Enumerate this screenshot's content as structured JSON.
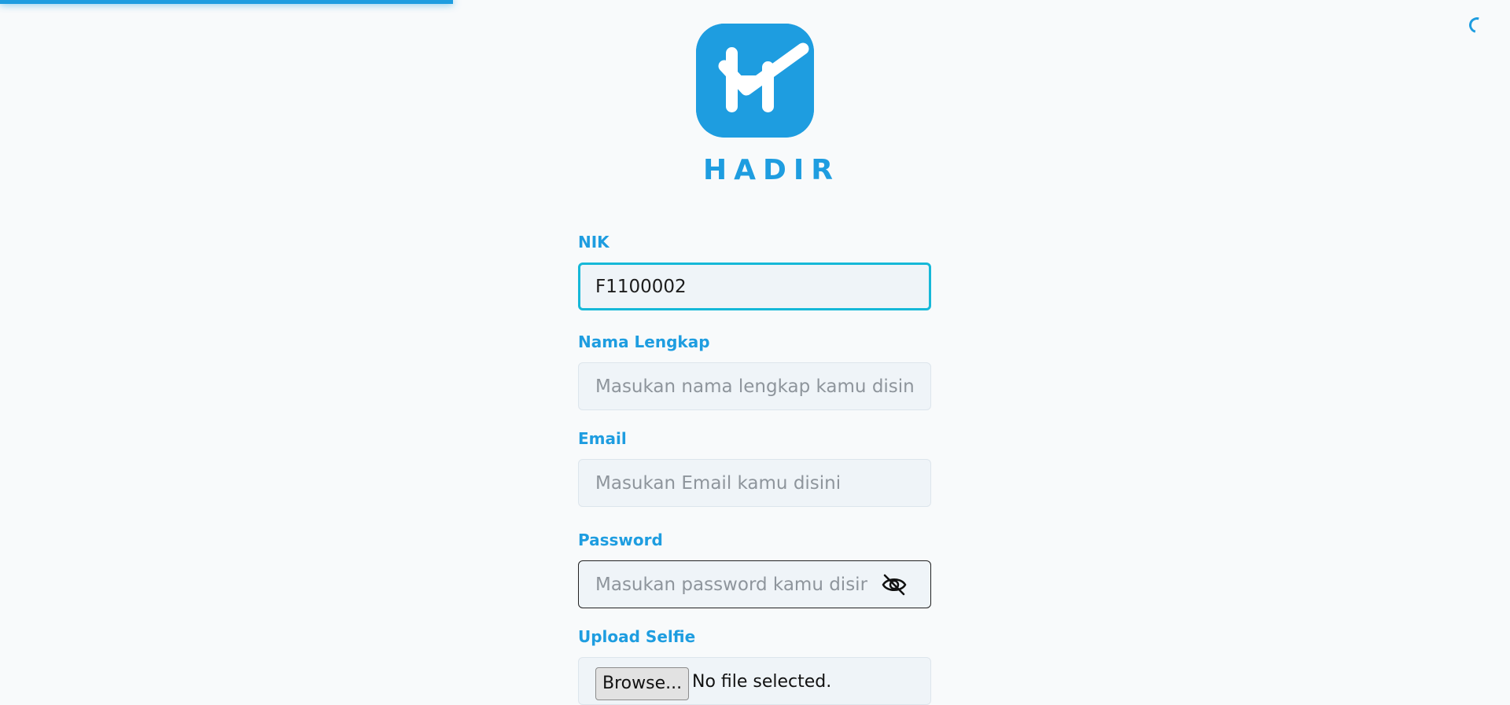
{
  "page_progress": {
    "percent": 30
  },
  "colors": {
    "accent": "#1e9de0",
    "focus": "#16b8d8",
    "input_bg": "#eff4f8"
  },
  "brand": {
    "name": "HADIR",
    "logo_icon": "h-checkmark-logo"
  },
  "form": {
    "nik": {
      "label": "NIK",
      "value": "F1100002",
      "placeholder": ""
    },
    "full_name": {
      "label": "Nama Lengkap",
      "value": "",
      "placeholder": "Masukan nama lengkap kamu disini"
    },
    "email": {
      "label": "Email",
      "value": "",
      "placeholder": "Masukan Email kamu disini"
    },
    "password": {
      "label": "Password",
      "value": "",
      "placeholder": "Masukan password kamu disini",
      "toggle_icon": "eye-off-icon"
    },
    "selfie": {
      "label": "Upload Selfie",
      "button_label": "Browse...",
      "status": "No file selected."
    }
  }
}
